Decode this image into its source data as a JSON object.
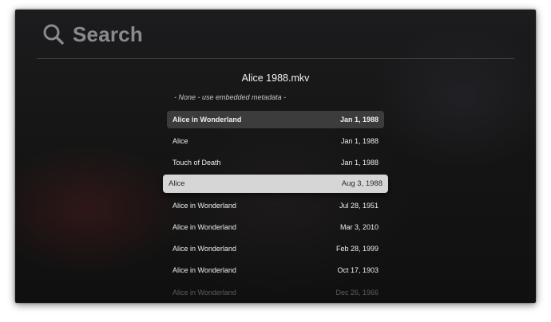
{
  "search": {
    "label": "Search",
    "icon": "search-icon"
  },
  "header": {
    "filename": "Alice 1988.mkv"
  },
  "none_option": {
    "label": "- None - use embedded metadata -"
  },
  "results": [
    {
      "title": "Alice in Wonderland",
      "date": "Jan 1, 1988"
    },
    {
      "title": "Alice",
      "date": "Jan 1, 1988"
    },
    {
      "title": "Touch of Death",
      "date": "Jan 1, 1988"
    },
    {
      "title": "Alice",
      "date": "Aug 3, 1988"
    },
    {
      "title": "Alice in Wonderland",
      "date": "Jul 28, 1951"
    },
    {
      "title": "Alice in Wonderland",
      "date": "Mar 3, 2010"
    },
    {
      "title": "Alice in Wonderland",
      "date": "Feb 28, 1999"
    },
    {
      "title": "Alice in Wonderland",
      "date": "Oct 17, 1903"
    },
    {
      "title": "Alice in Wonderland",
      "date": "Dec 26, 1966"
    }
  ],
  "state": {
    "hovered_index": 0,
    "selected_index": 3
  },
  "colors": {
    "selected_row_bg": "#d6d6d6",
    "hover_row_bg": "#3a3a3c",
    "search_text": "#8a8a8d"
  }
}
